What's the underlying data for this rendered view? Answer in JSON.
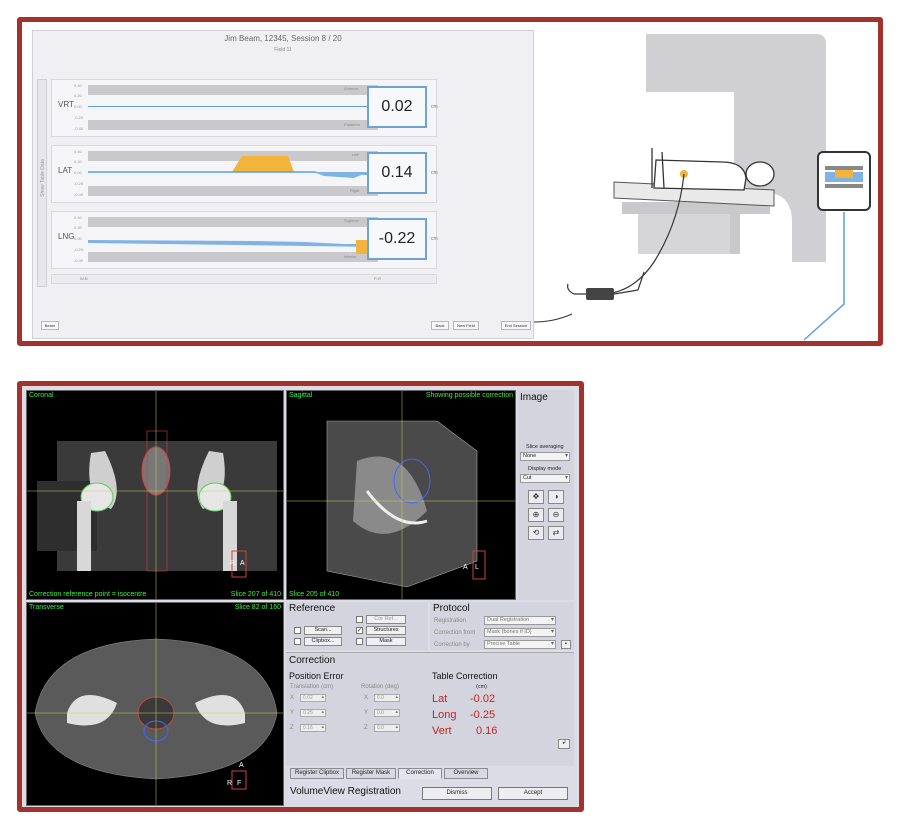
{
  "motion_app": {
    "title": "Jim Beam, 12345, Session 8 / 20",
    "field": "Field 11",
    "sidebar_label": "Show Table Data",
    "axis_label": "Deviation (cm)",
    "ticks": [
      "0.40",
      "0.20",
      "0.00",
      "-0.20",
      "-0.40"
    ],
    "rows": [
      {
        "label": "VRT",
        "value": "0.02",
        "unit": "cm",
        "top_tag": "Anterior",
        "bottom_tag": "Posterior"
      },
      {
        "label": "LAT",
        "value": "0.14",
        "unit": "cm",
        "top_tag": "Left",
        "bottom_tag": "Right"
      },
      {
        "label": "LNG",
        "value": "-0.22",
        "unit": "cm",
        "top_tag": "Superior",
        "bottom_tag": "Inferior"
      }
    ],
    "bottom_left": "W-B",
    "bottom_right": "P-R",
    "buttons": {
      "left": "Beam",
      "back": "Back",
      "new_field": "New Field",
      "end_session": "End Session"
    }
  },
  "volumeview": {
    "coronal_title": "Coronal",
    "coronal_footer_left": "Correction reference point = isocentre",
    "coronal_footer_right": "Slice 207 of 410",
    "sagittal_title": "Sagittal",
    "sagittal_note": "Showing possible correction",
    "sagittal_footer": "Slice 205 of 410",
    "transverse_title": "Transverse",
    "transverse_slice": "Slice 82 of 160",
    "orient_coronal": {
      "a": "R",
      "b": "A"
    },
    "orient_sagittal": {
      "a": "A",
      "b": "L"
    },
    "orient_transverse": {
      "a": "A",
      "b": "R",
      "c": "F"
    },
    "image_panel": {
      "title": "Image",
      "slice_averaging_label": "Slice averaging",
      "slice_averaging_value": "None",
      "display_mode_label": "Display mode",
      "display_mode_value": "Cut"
    },
    "reference": {
      "title": "Reference",
      "scan_btn": "Scan...",
      "clipbox_btn": "Clipbox...",
      "cor_ref": "Cor Ref...",
      "structures": "Structures",
      "mask": "Mask"
    },
    "protocol": {
      "title": "Protocol",
      "registration_label": "Registration",
      "registration_value": "Dual Registration",
      "correction_from_label": "Correction from",
      "correction_from_value": "Mask (bones if ID)",
      "correction_by_label": "Correction by",
      "correction_by_value": "Precise Table"
    },
    "correction": {
      "title": "Correction",
      "position_error": "Position Error",
      "translation_label": "Translation (cm)",
      "rotation_label": "Rotation (deg)",
      "axes": [
        "X",
        "Y",
        "Z"
      ],
      "translation_values": [
        "0.02",
        "0.25",
        "0.16"
      ],
      "rotation_values": [
        "0.0",
        "0.0",
        "0.0"
      ],
      "table_correction": "Table Correction",
      "cm": "(cm)",
      "lat_label": "Lat",
      "lat_value": "-0.02",
      "long_label": "Long",
      "long_value": "-0.25",
      "vert_label": "Vert",
      "vert_value": "0.16"
    },
    "tabs": [
      "Register Clipbox",
      "Register Mask",
      "Correction",
      "Overview"
    ],
    "footer_title": "VolumeView Registration",
    "dismiss": "Dismiss",
    "accept": "Accept"
  }
}
